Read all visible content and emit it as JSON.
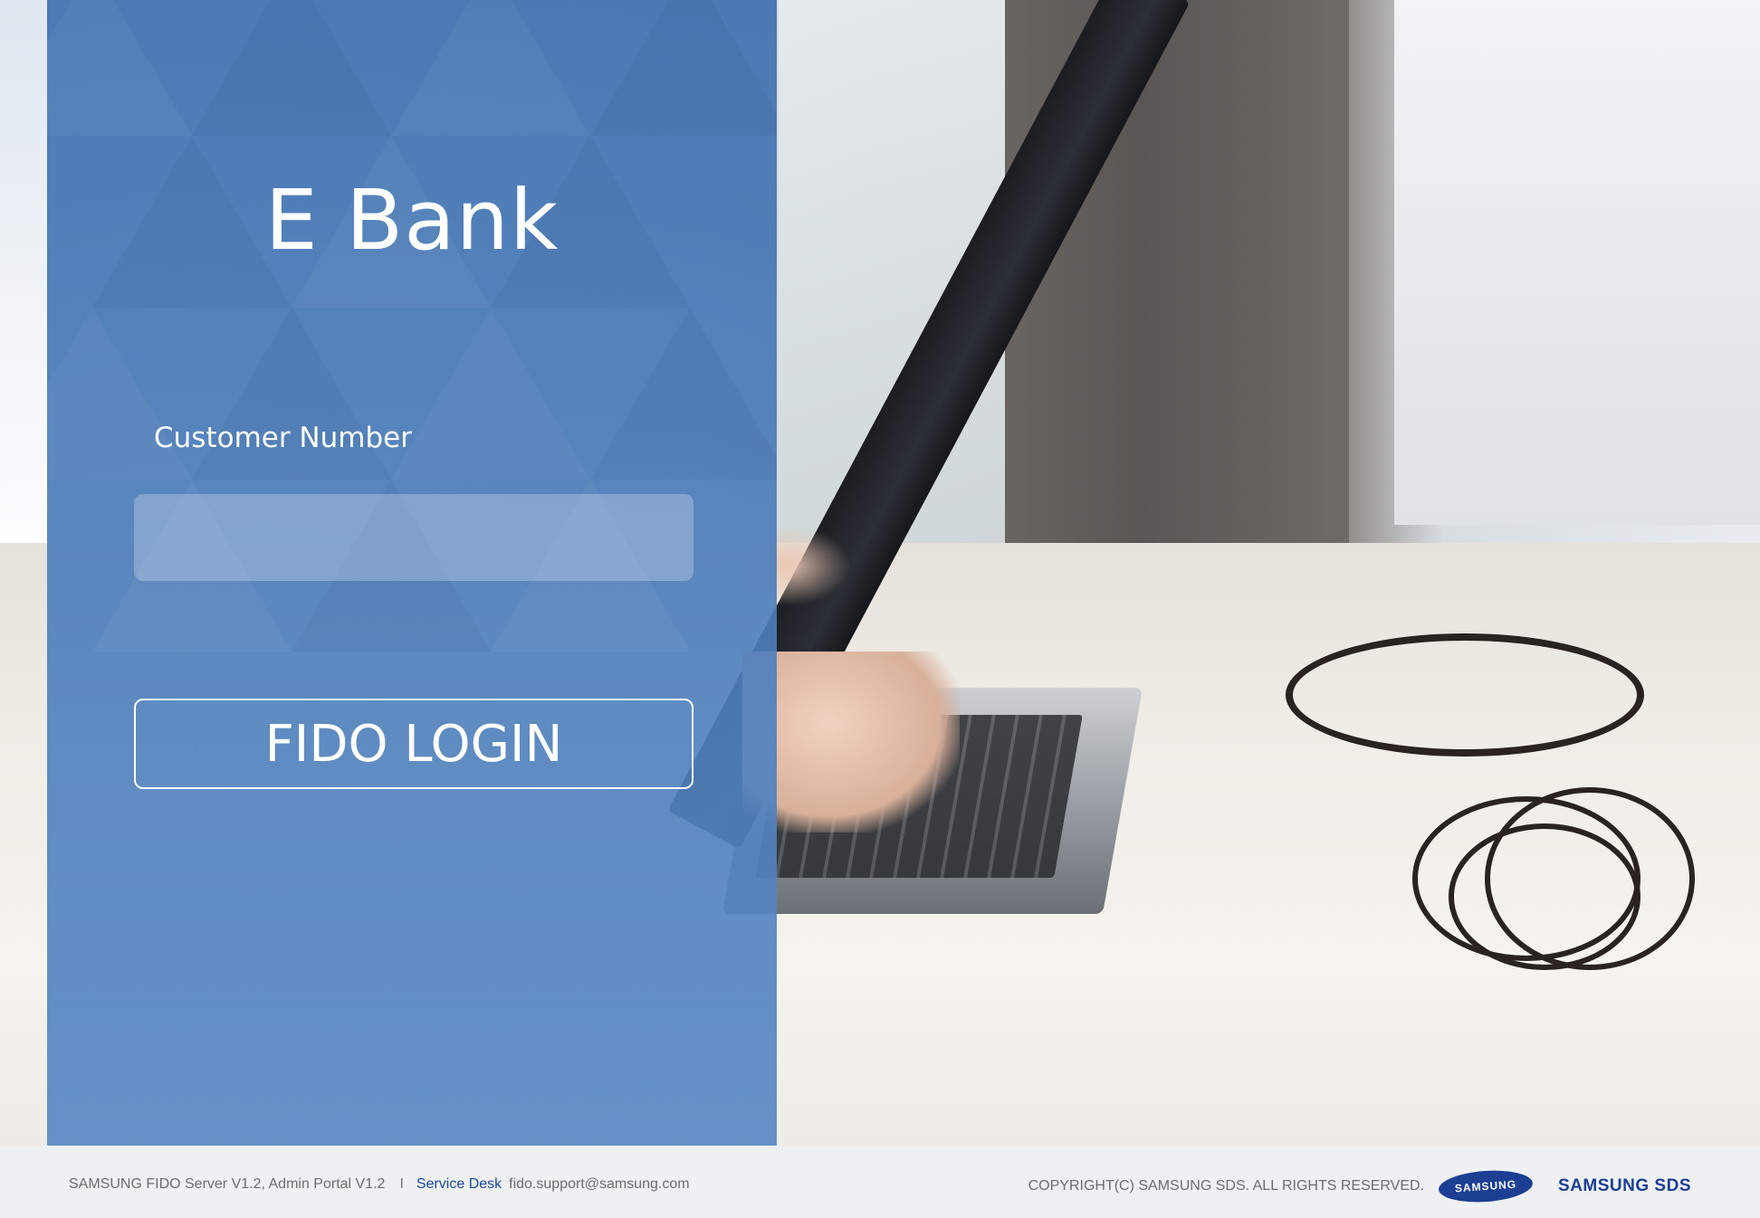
{
  "app": {
    "title": "E Bank"
  },
  "login": {
    "customer_number_label": "Customer Number",
    "customer_number_value": "",
    "login_button_label": "FIDO LOGIN"
  },
  "footer": {
    "product_info": "SAMSUNG FIDO Server V1.2, Admin Portal V1.2",
    "separator": "I",
    "service_desk_label": "Service Desk",
    "service_desk_email": "fido.support@samsung.com",
    "copyright": "COPYRIGHT(C) SAMSUNG SDS. ALL RIGHTS RESERVED.",
    "samsung_logo_text": "SAMSUNG",
    "sds_logo_text": "SAMSUNG SDS"
  },
  "colors": {
    "panel_blue": "#3e70b0",
    "footer_bg": "#eef0f2",
    "service_desk_link": "#1a4aa0",
    "brand_blue": "#1c3f93"
  }
}
